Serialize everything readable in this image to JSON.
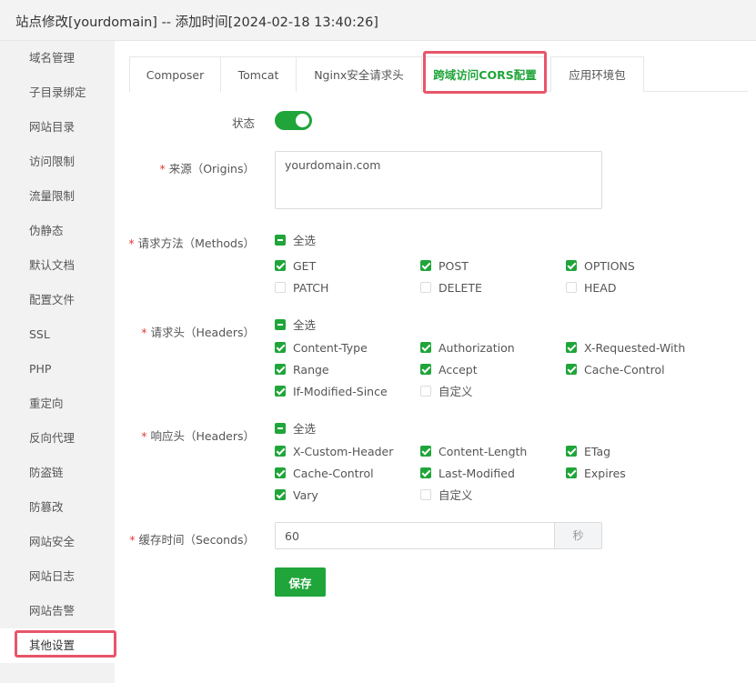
{
  "window": {
    "title": "站点修改[yourdomain] -- 添加时间[2024-02-18 13:40:26]"
  },
  "sidebar": {
    "items": [
      {
        "label": "域名管理"
      },
      {
        "label": "子目录绑定"
      },
      {
        "label": "网站目录"
      },
      {
        "label": "访问限制"
      },
      {
        "label": "流量限制"
      },
      {
        "label": "伪静态"
      },
      {
        "label": "默认文档"
      },
      {
        "label": "配置文件"
      },
      {
        "label": "SSL"
      },
      {
        "label": "PHP"
      },
      {
        "label": "重定向"
      },
      {
        "label": "反向代理"
      },
      {
        "label": "防盗链"
      },
      {
        "label": "防篡改"
      },
      {
        "label": "网站安全"
      },
      {
        "label": "网站日志"
      },
      {
        "label": "网站告警"
      },
      {
        "label": "其他设置"
      }
    ],
    "active": "其他设置"
  },
  "tabs": [
    {
      "label": "Composer"
    },
    {
      "label": "Tomcat"
    },
    {
      "label": "Nginx安全请求头"
    },
    {
      "label": "跨域访问CORS配置"
    },
    {
      "label": "应用环境包"
    }
  ],
  "active_tab": "跨域访问CORS配置",
  "form": {
    "status": {
      "label": "状态",
      "enabled": true
    },
    "origins": {
      "label": "来源（Origins）",
      "value": "yourdomain.com"
    },
    "methods": {
      "label": "请求方法（Methods）",
      "select_all": "全选",
      "options": [
        {
          "label": "GET",
          "checked": true
        },
        {
          "label": "POST",
          "checked": true
        },
        {
          "label": "OPTIONS",
          "checked": true
        },
        {
          "label": "PATCH",
          "checked": false
        },
        {
          "label": "DELETE",
          "checked": false
        },
        {
          "label": "HEAD",
          "checked": false
        }
      ]
    },
    "request_headers": {
      "label": "请求头（Headers）",
      "select_all": "全选",
      "options": [
        {
          "label": "Content-Type",
          "checked": true
        },
        {
          "label": "Authorization",
          "checked": true
        },
        {
          "label": "X-Requested-With",
          "checked": true
        },
        {
          "label": "Range",
          "checked": true
        },
        {
          "label": "Accept",
          "checked": true
        },
        {
          "label": "Cache-Control",
          "checked": true
        },
        {
          "label": "If-Modified-Since",
          "checked": true
        },
        {
          "label": "自定义",
          "checked": false
        }
      ]
    },
    "response_headers": {
      "label": "响应头（Headers）",
      "select_all": "全选",
      "options": [
        {
          "label": "X-Custom-Header",
          "checked": true
        },
        {
          "label": "Content-Length",
          "checked": true
        },
        {
          "label": "ETag",
          "checked": true
        },
        {
          "label": "Cache-Control",
          "checked": true
        },
        {
          "label": "Last-Modified",
          "checked": true
        },
        {
          "label": "Expires",
          "checked": true
        },
        {
          "label": "Vary",
          "checked": true
        },
        {
          "label": "自定义",
          "checked": false
        }
      ]
    },
    "cache": {
      "label": "缓存时间（Seconds）",
      "value": "60",
      "unit": "秒"
    },
    "save_label": "保存"
  },
  "colors": {
    "accent": "#20a53a",
    "highlight": "#e8556a",
    "required": "#e53935"
  }
}
